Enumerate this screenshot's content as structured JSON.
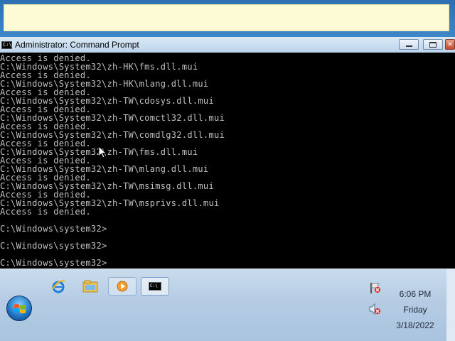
{
  "window": {
    "title": "Administrator: Command Prompt",
    "icon": "cmd-icon"
  },
  "console": {
    "lines": [
      "Access is denied.",
      "C:\\Windows\\System32\\zh-HK\\fms.dll.mui",
      "Access is denied.",
      "C:\\Windows\\System32\\zh-HK\\mlang.dll.mui",
      "Access is denied.",
      "C:\\Windows\\System32\\zh-TW\\cdosys.dll.mui",
      "Access is denied.",
      "C:\\Windows\\System32\\zh-TW\\comctl32.dll.mui",
      "Access is denied.",
      "C:\\Windows\\System32\\zh-TW\\comdlg32.dll.mui",
      "Access is denied.",
      "C:\\Windows\\System32\\zh-TW\\fms.dll.mui",
      "Access is denied.",
      "C:\\Windows\\System32\\zh-TW\\mlang.dll.mui",
      "Access is denied.",
      "C:\\Windows\\System32\\zh-TW\\msimsg.dll.mui",
      "Access is denied.",
      "C:\\Windows\\System32\\zh-TW\\msprivs.dll.mui",
      "Access is denied.",
      "",
      "C:\\Windows\\system32>",
      "",
      "C:\\Windows\\system32>",
      "",
      "C:\\Windows\\system32>"
    ],
    "text_color": "#c0c0c0",
    "background": "#000000"
  },
  "taskbar": {
    "apps": [
      {
        "name": "internet-explorer-icon"
      },
      {
        "name": "windows-explorer-icon"
      },
      {
        "name": "media-player-icon"
      },
      {
        "name": "command-prompt-icon"
      }
    ],
    "clock": {
      "time": "6:06 PM",
      "day": "Friday",
      "date": "3/18/2022"
    }
  }
}
